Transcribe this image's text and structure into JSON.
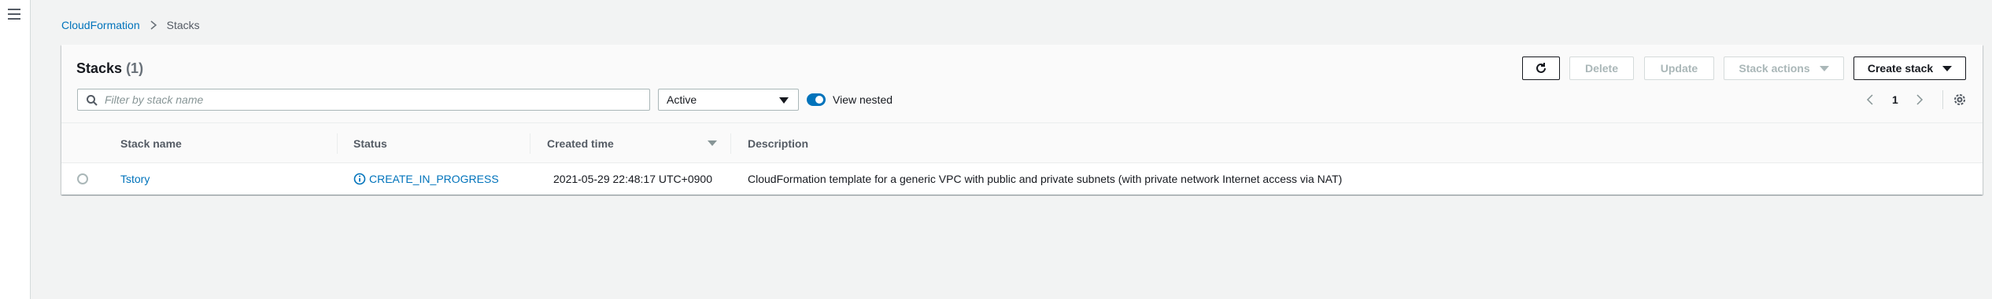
{
  "breadcrumb": {
    "root": "CloudFormation",
    "current": "Stacks"
  },
  "panel": {
    "title": "Stacks",
    "count": "(1)"
  },
  "toolbar": {
    "delete_label": "Delete",
    "update_label": "Update",
    "stack_actions_label": "Stack actions",
    "create_stack_label": "Create stack"
  },
  "filter": {
    "placeholder": "Filter by stack name",
    "status_selected": "Active",
    "view_nested_label": "View nested",
    "view_nested_on": true
  },
  "pagination": {
    "current_page": "1"
  },
  "table": {
    "columns": [
      "Stack name",
      "Status",
      "Created time",
      "Description"
    ],
    "rows": [
      {
        "stack_name": "Tstory",
        "status": "CREATE_IN_PROGRESS",
        "created_time": "2021-05-29 22:48:17 UTC+0900",
        "description": "CloudFormation template for a generic VPC with public and private subnets (with private network Internet access via NAT)"
      }
    ]
  },
  "colors": {
    "accent": "#0073bb",
    "background": "#f2f3f3",
    "disabled": "#aab7b8"
  },
  "icons": [
    "menu-icon",
    "chevron-right-icon",
    "refresh-icon",
    "caret-down-icon",
    "search-icon",
    "chevron-left-icon",
    "gear-icon",
    "sort-desc-icon",
    "info-icon"
  ]
}
